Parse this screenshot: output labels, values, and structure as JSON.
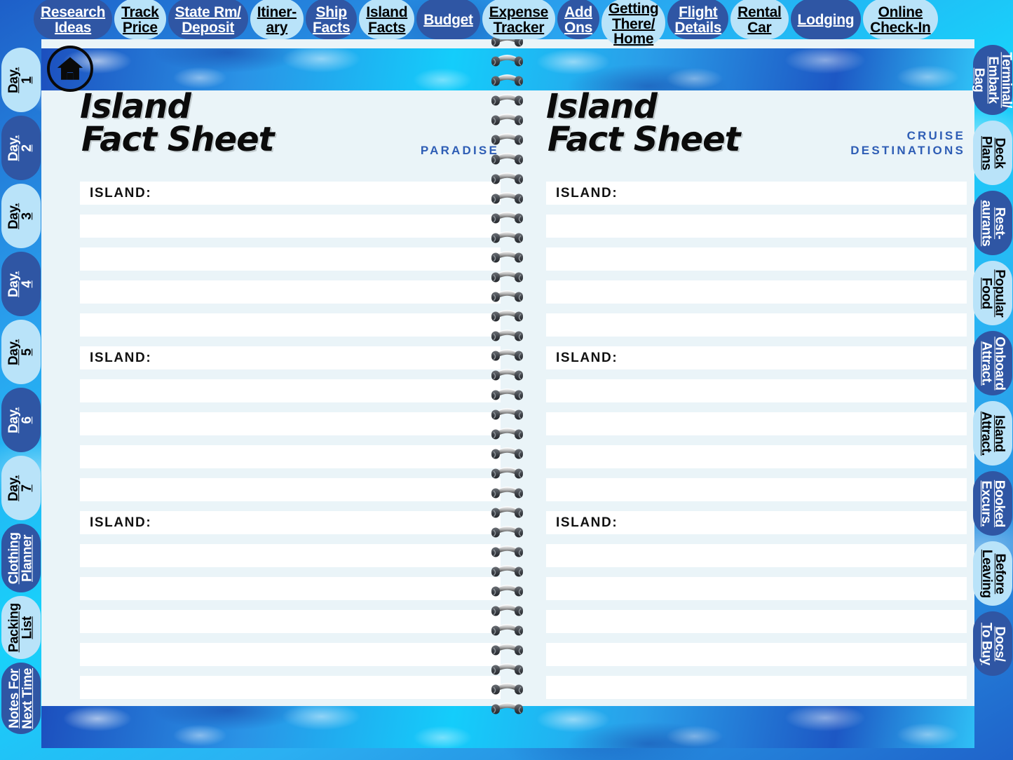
{
  "colors": {
    "tab_dark": "#2f56a4",
    "tab_light": "#b9e3f9",
    "page_bg": "#eaf4f8",
    "kicker_blue": "#2e5db5",
    "row_white": "#ffffff"
  },
  "top_tabs": [
    {
      "label_lines": [
        "Research",
        "Ideas"
      ],
      "style": "dark"
    },
    {
      "label_lines": [
        "Track",
        "Price"
      ],
      "style": "light"
    },
    {
      "label_lines": [
        "State Rm/",
        "Deposit"
      ],
      "style": "dark"
    },
    {
      "label_lines": [
        "Itiner-",
        "ary"
      ],
      "style": "light"
    },
    {
      "label_lines": [
        "Ship",
        "Facts"
      ],
      "style": "dark"
    },
    {
      "label_lines": [
        "Island",
        "Facts"
      ],
      "style": "light"
    },
    {
      "label_lines": [
        "Budget"
      ],
      "style": "dark"
    },
    {
      "label_lines": [
        "Expense",
        "Tracker"
      ],
      "style": "light"
    },
    {
      "label_lines": [
        "Add",
        "Ons"
      ],
      "style": "dark"
    },
    {
      "label_lines": [
        "Getting",
        "There/",
        "Home"
      ],
      "style": "light"
    },
    {
      "label_lines": [
        "Flight",
        "Details"
      ],
      "style": "dark"
    },
    {
      "label_lines": [
        "Rental",
        "Car"
      ],
      "style": "light"
    },
    {
      "label_lines": [
        "Lodging"
      ],
      "style": "dark"
    },
    {
      "label_lines": [
        "Online",
        "Check-In"
      ],
      "style": "light"
    }
  ],
  "left_tabs": [
    {
      "label_lines": [
        "Day.",
        "1"
      ],
      "style": "light"
    },
    {
      "label_lines": [
        "Day.",
        "2"
      ],
      "style": "dark"
    },
    {
      "label_lines": [
        "Day.",
        "3"
      ],
      "style": "light"
    },
    {
      "label_lines": [
        "Day.",
        "4"
      ],
      "style": "dark"
    },
    {
      "label_lines": [
        "Day.",
        "5"
      ],
      "style": "light"
    },
    {
      "label_lines": [
        "Day.",
        "6"
      ],
      "style": "dark"
    },
    {
      "label_lines": [
        "Day.",
        "7"
      ],
      "style": "light"
    },
    {
      "label_lines": [
        "Clothing",
        "Planner"
      ],
      "style": "dark"
    },
    {
      "label_lines": [
        "Packing",
        "List"
      ],
      "style": "light"
    },
    {
      "label_lines": [
        "Notes For",
        "Next Time"
      ],
      "style": "dark"
    }
  ],
  "right_tabs": [
    {
      "label_lines": [
        "Terminal/",
        "Embark",
        "Bag"
      ],
      "style": "dark"
    },
    {
      "label_lines": [
        "Deck",
        "Plans"
      ],
      "style": "light"
    },
    {
      "label_lines": [
        "Rest-",
        "aurants"
      ],
      "style": "dark"
    },
    {
      "label_lines": [
        "Popular",
        "Food"
      ],
      "style": "light"
    },
    {
      "label_lines": [
        "Onboard",
        "Attract."
      ],
      "style": "dark"
    },
    {
      "label_lines": [
        "Island",
        "Attract."
      ],
      "style": "light"
    },
    {
      "label_lines": [
        "Booked",
        "Excurs."
      ],
      "style": "dark"
    },
    {
      "label_lines": [
        "Before",
        "Leaving"
      ],
      "style": "light"
    },
    {
      "label_lines": [
        "Docs/",
        "To Buy"
      ],
      "style": "dark"
    }
  ],
  "home_button": {
    "icon": "home-icon"
  },
  "pages": {
    "left": {
      "title_line1": "Island",
      "title_line2": "Fact Sheet",
      "kicker": "PARADISE",
      "blocks": [
        {
          "header": "ISLAND:",
          "blank_rows": 4
        },
        {
          "header": "ISLAND:",
          "blank_rows": 4
        },
        {
          "header": "ISLAND:",
          "blank_rows": 5
        }
      ]
    },
    "right": {
      "title_line1": "Island",
      "title_line2": "Fact Sheet",
      "kicker_line1": "CRUISE",
      "kicker_line2": "DESTINATIONS",
      "blocks": [
        {
          "header": "ISLAND:",
          "blank_rows": 4
        },
        {
          "header": "ISLAND:",
          "blank_rows": 4
        },
        {
          "header": "ISLAND:",
          "blank_rows": 5
        }
      ]
    }
  },
  "spiral": {
    "ring_count": 36,
    "icon": "spiral-ring-icon"
  }
}
